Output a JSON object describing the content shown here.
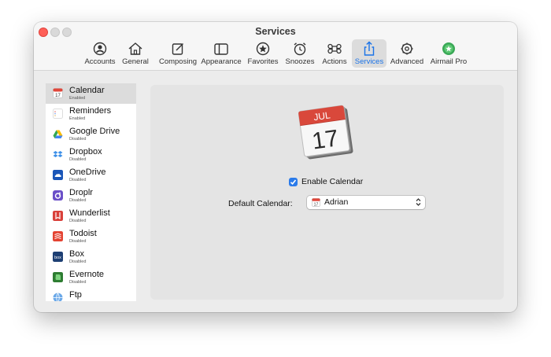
{
  "window": {
    "title": "Services"
  },
  "toolbar": {
    "items": [
      {
        "label": "Accounts",
        "icon": "person-circle-icon"
      },
      {
        "label": "General",
        "icon": "house-icon"
      },
      {
        "label": "Composing",
        "icon": "compose-icon"
      },
      {
        "label": "Appearance",
        "icon": "sidebar-icon"
      },
      {
        "label": "Favorites",
        "icon": "star-circle-icon"
      },
      {
        "label": "Snoozes",
        "icon": "alarm-icon"
      },
      {
        "label": "Actions",
        "icon": "command-icon"
      },
      {
        "label": "Services",
        "icon": "share-icon"
      },
      {
        "label": "Advanced",
        "icon": "gear-icon"
      },
      {
        "label": "Airmail Pro",
        "icon": "pro-badge-icon"
      }
    ],
    "active": "Services",
    "active_color": "#1a73e8"
  },
  "sidebar": {
    "items": [
      {
        "name": "Calendar",
        "status": "Enabled"
      },
      {
        "name": "Reminders",
        "status": "Enabled"
      },
      {
        "name": "Google Drive",
        "status": "Disabled"
      },
      {
        "name": "Dropbox",
        "status": "Disabled"
      },
      {
        "name": "OneDrive",
        "status": "Disabled"
      },
      {
        "name": "Droplr",
        "status": "Disabled"
      },
      {
        "name": "Wunderlist",
        "status": "Disabled"
      },
      {
        "name": "Todoist",
        "status": "Disabled"
      },
      {
        "name": "Box",
        "status": "Disabled"
      },
      {
        "name": "Evernote",
        "status": "Disabled"
      },
      {
        "name": "Ftp",
        "status": ""
      }
    ],
    "selected": "Calendar"
  },
  "detail": {
    "calendar_month": "JUL",
    "calendar_day": "17",
    "enable_label": "Enable Calendar",
    "enable_checked": true,
    "default_calendar_label": "Default Calendar:",
    "default_calendar_value": "Adrian",
    "select_icon_day": "17"
  }
}
